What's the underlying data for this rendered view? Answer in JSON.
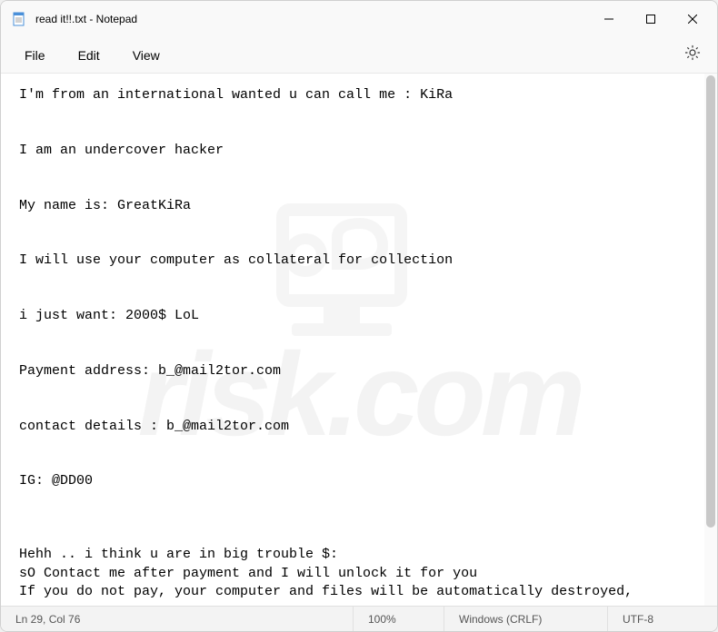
{
  "titlebar": {
    "title": "read it!!.txt - Notepad"
  },
  "menubar": {
    "file": "File",
    "edit": "Edit",
    "view": "View"
  },
  "content": {
    "text": "I'm from an international wanted u can call me : KiRa\n\n\nI am an undercover hacker\n\n\nMy name is: GreatKiRa\n\n\nI will use your computer as collateral for collection\n\n\ni just want: 2000$ LoL\n\n\nPayment address: b_@mail2tor.com\n\n\ncontact details : b_@mail2tor.com\n\n\nIG: @DD00\n\n\n\nHehh .. i think u are in big trouble $:\nsO Contact me after payment and I will unlock it for you\nIf you do not pay, your computer and files will be automatically destroyed,"
  },
  "statusbar": {
    "position": "Ln 29, Col 76",
    "zoom": "100%",
    "eol": "Windows (CRLF)",
    "encoding": "UTF-8"
  },
  "watermark": {
    "text": "risk.com"
  }
}
